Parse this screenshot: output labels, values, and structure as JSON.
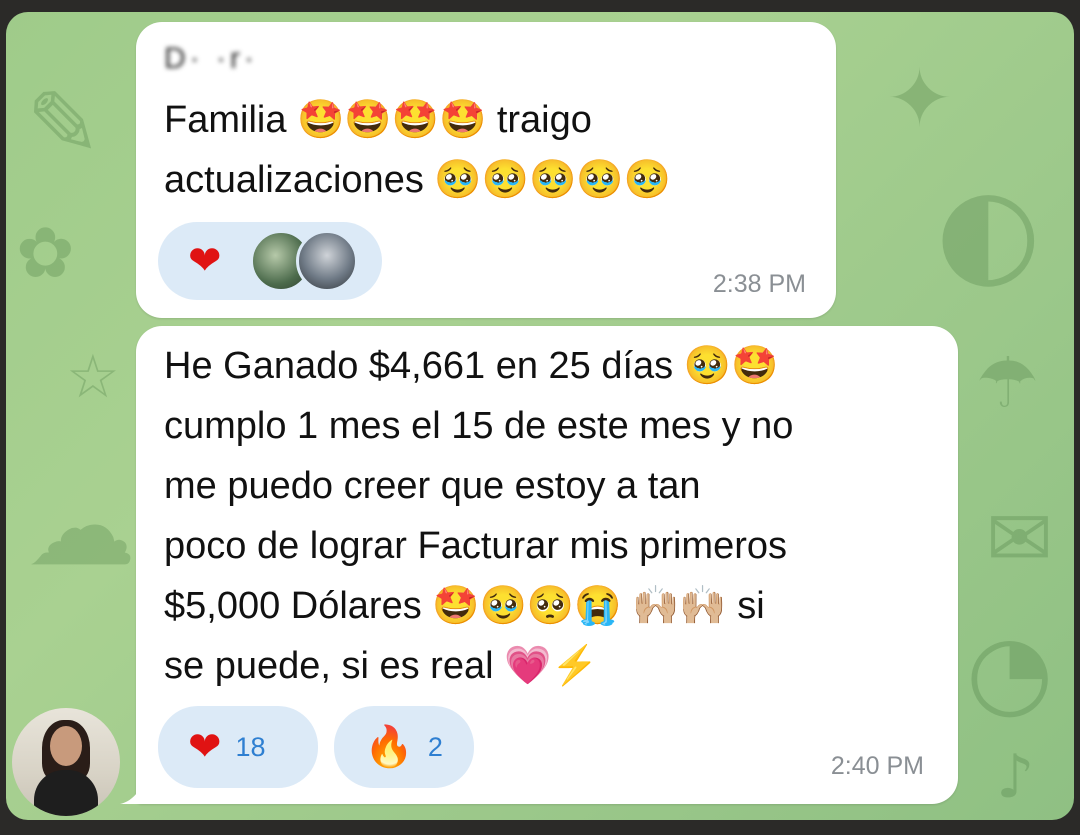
{
  "chat": {
    "messages": [
      {
        "sender": "D· ·r·",
        "text": "Familia 🤩🤩🤩🤩 traigo\nactualizaciones 🥹🥹🥹🥹🥹",
        "reaction_icon": "heart-icon",
        "time": "2:38 PM"
      },
      {
        "text": "He Ganado $4,661 en 25 días 🥹🤩\ncumplo 1 mes el 15 de este mes y no\nme puedo creer que estoy a tan\npoco de lograr Facturar mis primeros\n$5,000 Dólares 🤩🥹🥺😭 🙌🏼🙌🏼 si\nse puede, si es real 💗⚡",
        "reactions": [
          {
            "icon": "heart-icon",
            "count": "18"
          },
          {
            "icon": "fire-icon",
            "count": "2"
          }
        ],
        "time": "2:40 PM"
      }
    ]
  },
  "colors": {
    "chat_background": "#a9d191",
    "bubble": "#ffffff",
    "reaction_pill": "#dceaf7",
    "reaction_count": "#2e7fd1",
    "timestamp": "#8a8f94"
  }
}
